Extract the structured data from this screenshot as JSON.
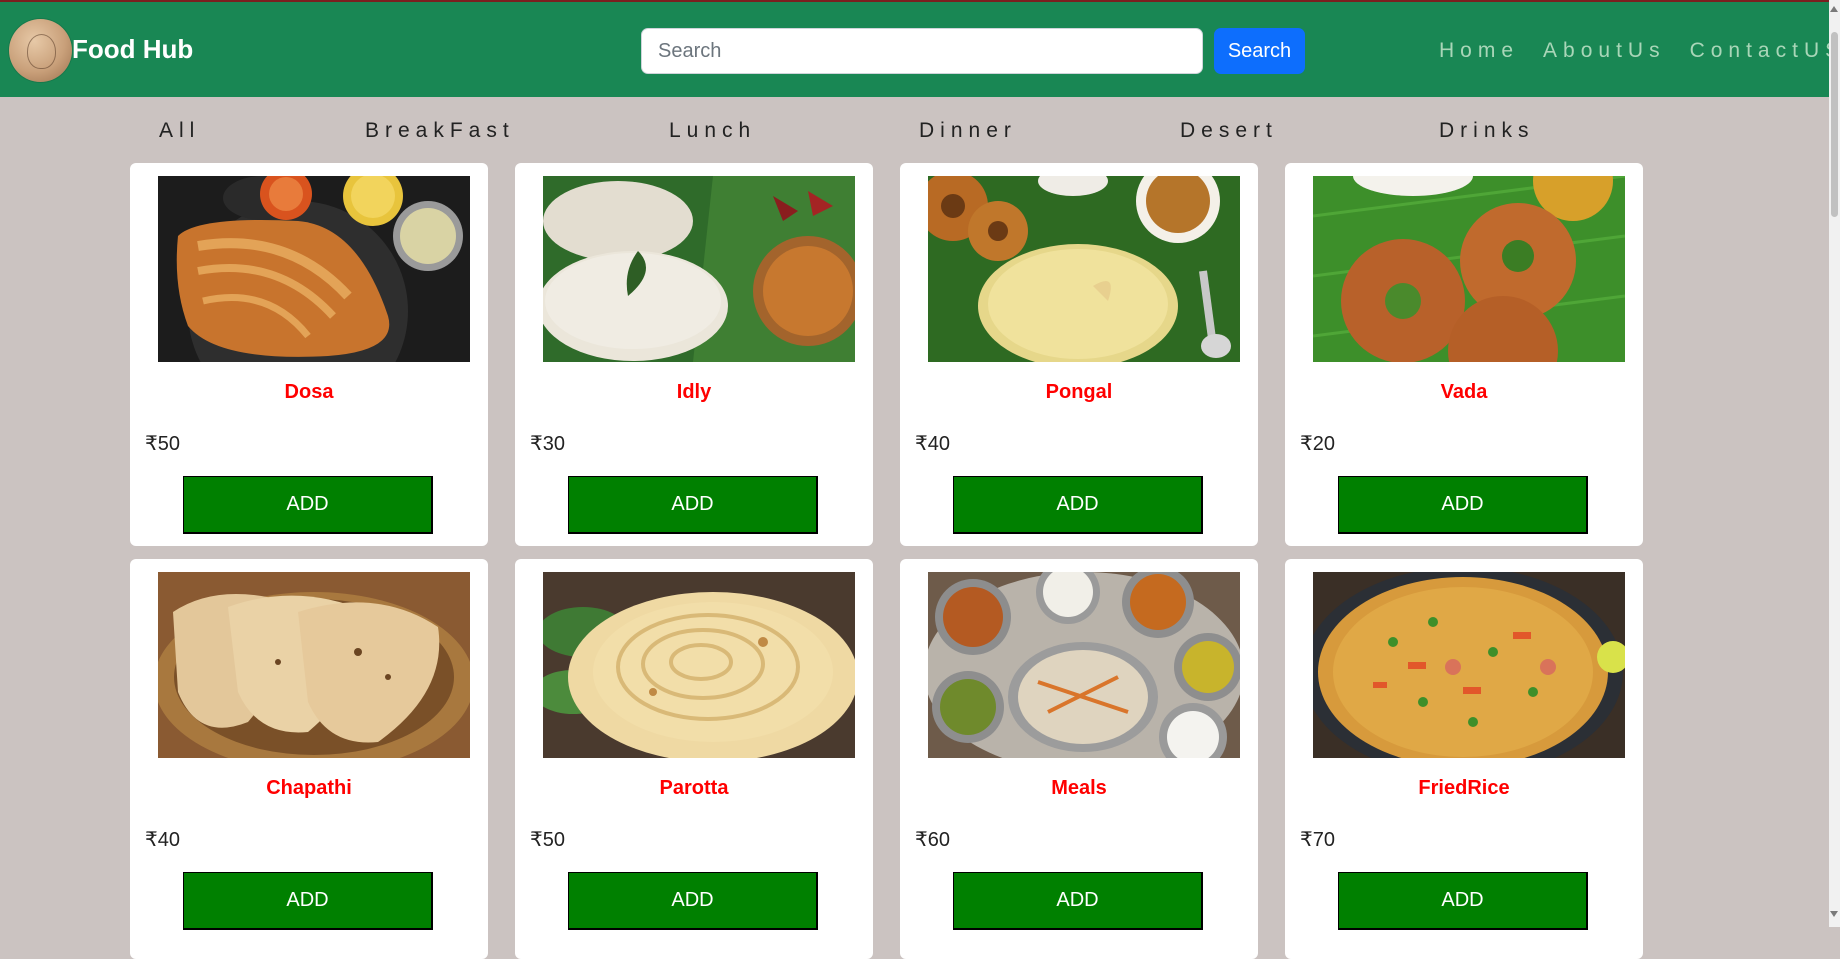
{
  "header": {
    "brand": "Food Hub",
    "search_placeholder": "Search",
    "search_button": "Search",
    "nav": [
      "Home",
      "AboutUs",
      "ContactUS"
    ],
    "logo_icon": "restaurant-logo-icon"
  },
  "categories": [
    "All",
    "BreakFast",
    "Lunch",
    "Dinner",
    "Desert",
    "Drinks"
  ],
  "items": [
    {
      "name": "Dosa",
      "price": "₹50",
      "button": "ADD"
    },
    {
      "name": "Idly",
      "price": "₹30",
      "button": "ADD"
    },
    {
      "name": "Pongal",
      "price": "₹40",
      "button": "ADD"
    },
    {
      "name": "Vada",
      "price": "₹20",
      "button": "ADD"
    },
    {
      "name": "Chapathi",
      "price": "₹40",
      "button": "ADD"
    },
    {
      "name": "Parotta",
      "price": "₹50",
      "button": "ADD"
    },
    {
      "name": "Meals",
      "price": "₹60",
      "button": "ADD"
    },
    {
      "name": "FriedRice",
      "price": "₹70",
      "button": "ADD"
    }
  ],
  "colors": {
    "navbar": "#198754",
    "page_background": "#cbc3c1",
    "search_button": "#0d6efd",
    "add_button": "#008000",
    "item_title": "#ff0000"
  }
}
